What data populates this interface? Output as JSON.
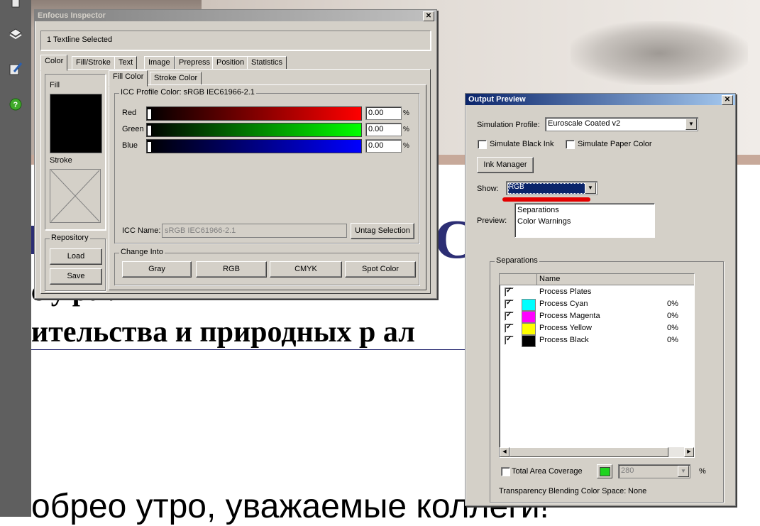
{
  "document": {
    "line1": "c                 у ра                ля",
    "line2": "ительства и природных р                  ал",
    "line3": "обрео утро, уважаемые коллеги!",
    "accent_color": "#2c2e74"
  },
  "inspector": {
    "title": "Enfocus Inspector",
    "selection_info": "1 Textline Selected",
    "tabs": [
      "Color",
      "Fill/Stroke",
      "Text",
      "Image",
      "Prepress",
      "Position",
      "Statistics"
    ],
    "active_tab": "Color",
    "fill_label": "Fill",
    "stroke_label": "Stroke",
    "subtabs": [
      "Fill Color",
      "Stroke Color"
    ],
    "profile_group": "ICC Profile Color: sRGB IEC61966-2.1",
    "channels": [
      {
        "label": "Red",
        "value": "0.00",
        "unit": "%",
        "color": "#ff0000"
      },
      {
        "label": "Green",
        "value": "0.00",
        "unit": "%",
        "color": "#00ff00"
      },
      {
        "label": "Blue",
        "value": "0.00",
        "unit": "%",
        "color": "#0000ff"
      }
    ],
    "icc_name_label": "ICC Name:",
    "icc_name_value": "sRGB IEC61966-2.1",
    "untag_button": "Untag Selection",
    "change_into_label": "Change Into",
    "change_buttons": [
      "Gray",
      "RGB",
      "CMYK",
      "Spot Color"
    ],
    "repository_label": "Repository",
    "load_button": "Load",
    "save_button": "Save"
  },
  "output_preview": {
    "title": "Output Preview",
    "simulation_profile_label": "Simulation Profile:",
    "simulation_profile_value": "Euroscale Coated v2",
    "simulate_black_ink": "Simulate Black Ink",
    "simulate_paper_color": "Simulate Paper Color",
    "ink_manager_button": "Ink Manager",
    "show_label": "Show:",
    "show_value": "RGB",
    "preview_label": "Preview:",
    "preview_options": [
      "Separations",
      "Color Warnings"
    ],
    "separations_group": "Separations",
    "table_header": "Name",
    "separations": [
      {
        "name": "Process Plates",
        "checked": true,
        "percent": "",
        "color": ""
      },
      {
        "name": "Process Cyan",
        "checked": true,
        "percent": "0%",
        "color": "#00ffff"
      },
      {
        "name": "Process Magenta",
        "checked": true,
        "percent": "0%",
        "color": "#ff00ff"
      },
      {
        "name": "Process Yellow",
        "checked": true,
        "percent": "0%",
        "color": "#ffff00"
      },
      {
        "name": "Process Black",
        "checked": true,
        "percent": "0%",
        "color": "#000000"
      }
    ],
    "total_area_coverage": "Total Area Coverage",
    "coverage_color": "#1fd41f",
    "coverage_value": "280",
    "coverage_unit": "%",
    "blending_label": "Transparency Blending Color Space:",
    "blending_value": "None"
  }
}
